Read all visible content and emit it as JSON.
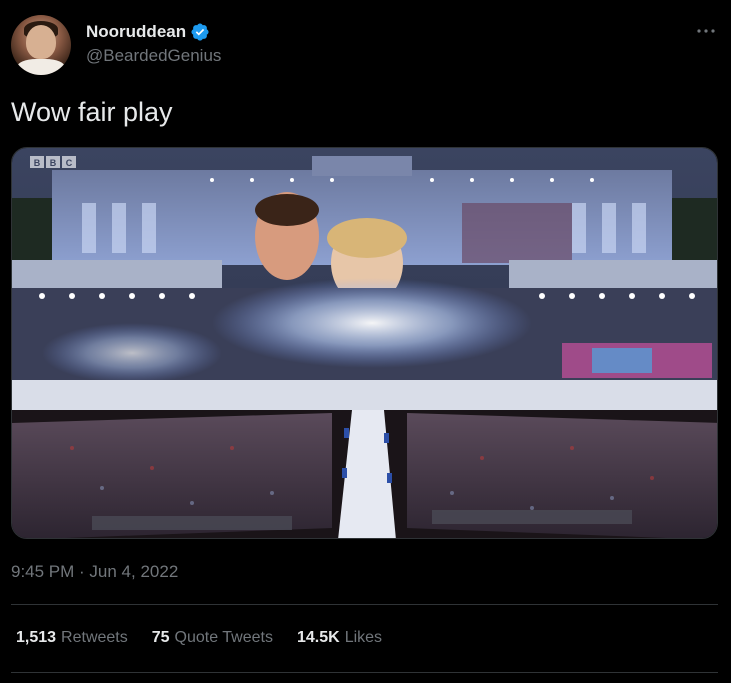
{
  "author": {
    "display_name": "Nooruddean",
    "handle": "@BeardedGenius",
    "verified": true,
    "verified_color": "#1d9bf0"
  },
  "tweet": {
    "text": "Wow fair play",
    "timestamp": "9:45 PM · Jun 4, 2022"
  },
  "media": {
    "broadcaster_logo": "BBC"
  },
  "stats": {
    "retweets": {
      "count": "1,513",
      "label": "Retweets"
    },
    "quote_tweets": {
      "count": "75",
      "label": "Quote Tweets"
    },
    "likes": {
      "count": "14.5K",
      "label": "Likes"
    }
  },
  "icons": {
    "more": "more-horizontal-icon",
    "verified": "verified-badge-icon"
  },
  "colors": {
    "background": "#000000",
    "primary_text": "#e7e9ea",
    "secondary_text": "#71767b",
    "divider": "#2f3336"
  }
}
